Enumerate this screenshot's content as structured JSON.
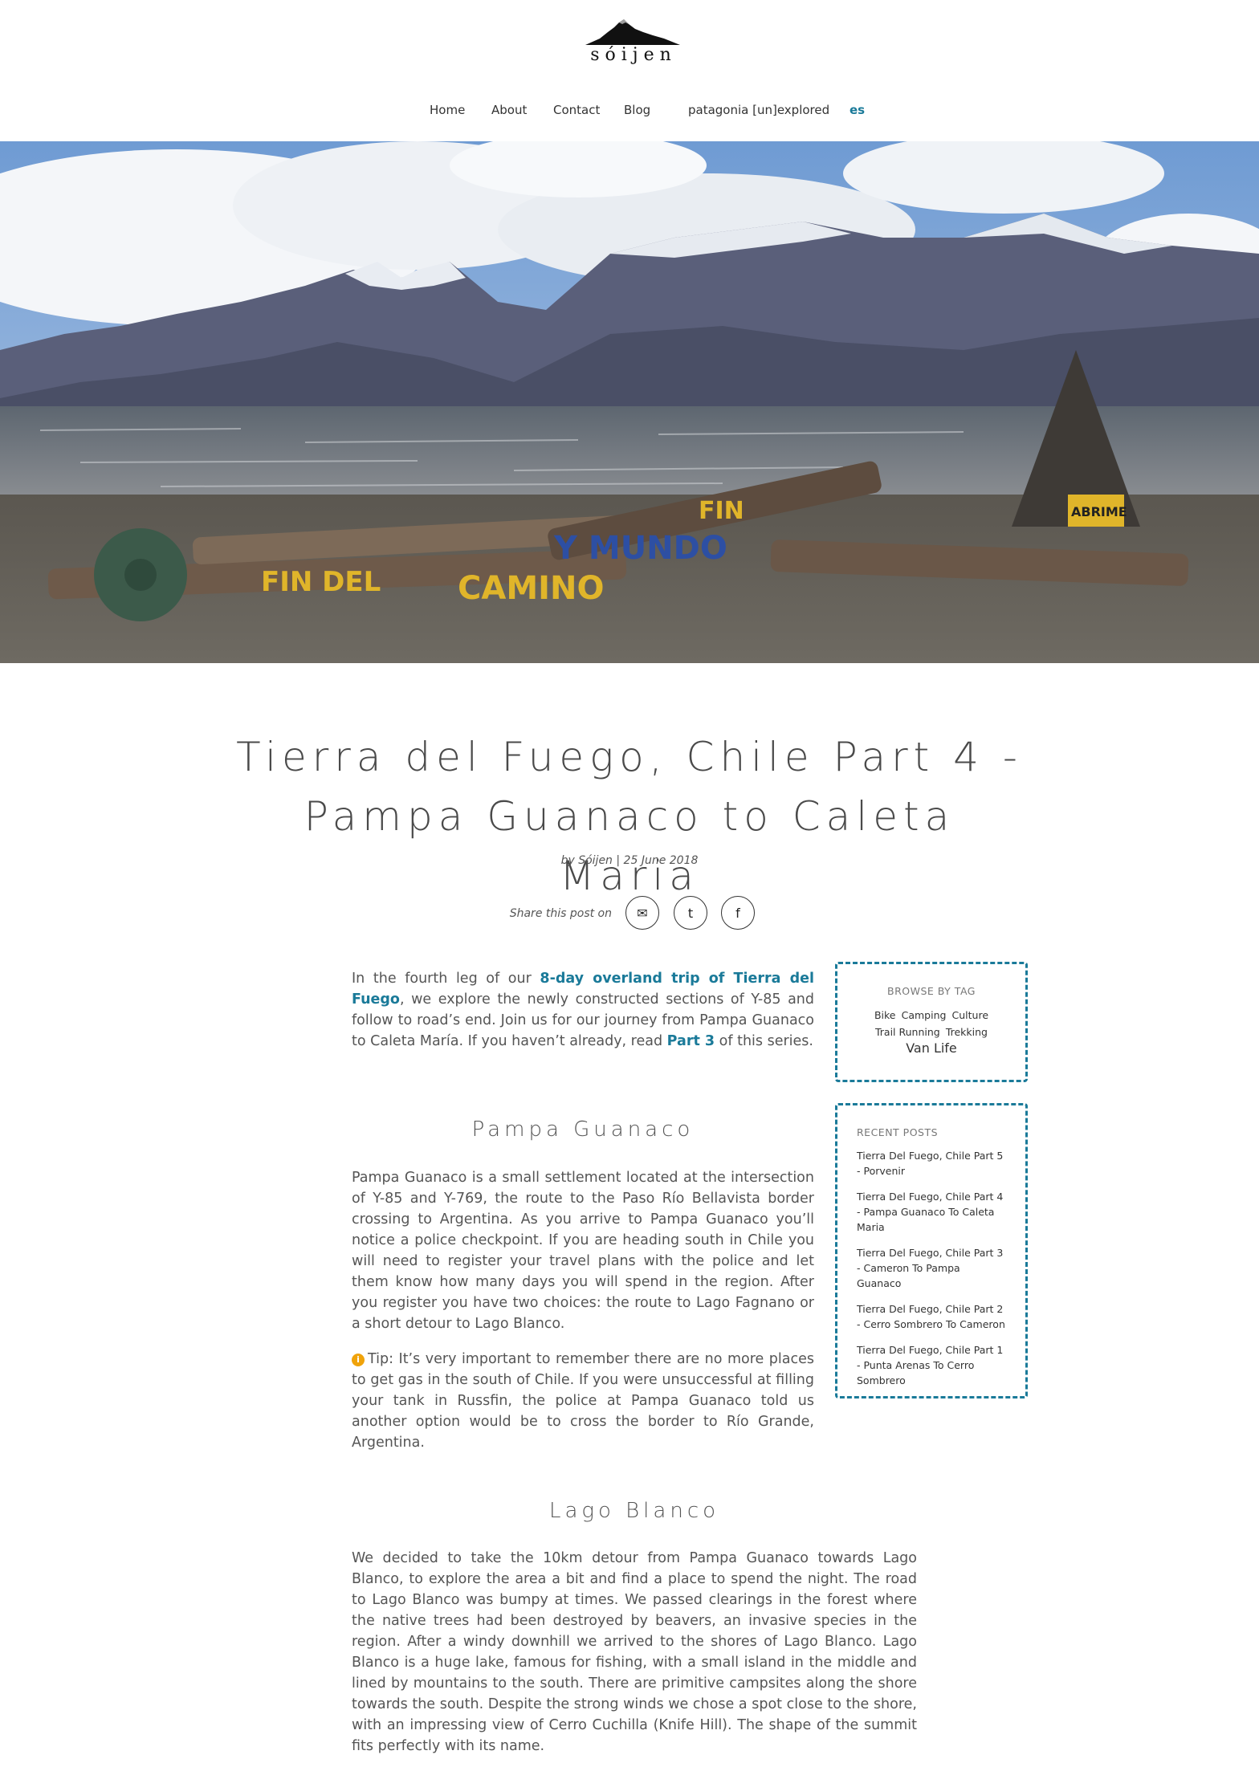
{
  "site": {
    "logo_text": "sóijen"
  },
  "nav": {
    "items": [
      "Home",
      "About",
      "Contact",
      "Blog",
      "patagonia [un]explored"
    ],
    "lang": "es"
  },
  "hero": {
    "alt_signs": [
      "FIN DEL",
      "CAMINO",
      "Y MUNDO",
      "FIN",
      "ABRIME"
    ]
  },
  "post": {
    "title_line1": "Tierra del Fuego, Chile Part 4 -",
    "title_line2": "Pampa Guanaco to Caleta Maria",
    "meta": "by Sóijen | 25 June 2018",
    "share_label": "Share this post on",
    "share_buttons": [
      {
        "name": "email",
        "icon": "envelope-icon",
        "glyph": "✉"
      },
      {
        "name": "twitter",
        "icon": "twitter-icon",
        "glyph": "t"
      },
      {
        "name": "facebook",
        "icon": "facebook-icon",
        "glyph": "f"
      }
    ],
    "intro": {
      "before_link": "In the fourth leg of our ",
      "link1": "8-day overland trip of Tierra del Fuego",
      "middle": ", we explore the newly constructed sections of Y-85 and follow to road’s end. Join us for our journey from Pampa Guanaco to Caleta María. If you haven’t already, read ",
      "link2": "Part 3",
      "after_link": " of this series."
    },
    "section1": {
      "heading": "Pampa Guanaco",
      "paragraph": "Pampa Guanaco is a small settlement located at the intersection of Y-85 and Y-769, the route to the Paso Río Bellavista border crossing to Argentina. As you arrive to Pampa Guanaco you’ll notice a police checkpoint. If you are heading south in Chile you will need to register your travel plans with the police and let them know how many days you will spend in the region. After you register you have two choices: the route to Lago Fagnano or a short detour to Lago Blanco.",
      "tip": "Tip: It’s very important to remember there are no more places to get gas in the south of Chile. If you were unsuccessful at filling your tank in Russfin, the police at Pampa Guanaco told us another option would be to cross the border to Río Grande, Argentina."
    },
    "section2": {
      "heading": "Lago Blanco",
      "paragraph": "We decided to take the 10km detour from Pampa Guanaco towards Lago Blanco, to explore the area a bit and find a place to spend the night. The road to Lago Blanco was bumpy at times. We passed clearings in the forest where the native trees had been destroyed by beavers, an invasive species in the region. After a windy downhill we arrived to the shores of Lago Blanco. Lago Blanco is a huge lake, famous for fishing, with a small island in the middle and lined by mountains to the south. There are primitive campsites along the shore towards the south. Despite the strong winds we chose a spot close to the shore, with an impressing view of Cerro Cuchilla (Knife Hill). The shape of the summit fits perfectly with its name."
    }
  },
  "sidebar": {
    "tags_title": "BROWSE BY TAG",
    "tags_row1": [
      "Bike",
      "Camping",
      "Culture"
    ],
    "tags_row2": [
      "Trail Running",
      "Trekking"
    ],
    "tags_big": "Van Life",
    "recent_title": "RECENT POSTS",
    "recent": [
      "Tierra Del Fuego, Chile Part 5 - Porvenir",
      "Tierra Del Fuego, Chile Part 4 - Pampa Guanaco To Caleta Maria",
      "Tierra Del Fuego, Chile Part 3 - Cameron To Pampa Guanaco",
      "Tierra Del Fuego, Chile Part 2 - Cerro Sombrero To Cameron",
      "Tierra Del Fuego, Chile Part 1 - Punta Arenas To Cerro Sombrero"
    ]
  },
  "colors": {
    "accent": "#1a7a99",
    "tip": "#f0a30a"
  }
}
